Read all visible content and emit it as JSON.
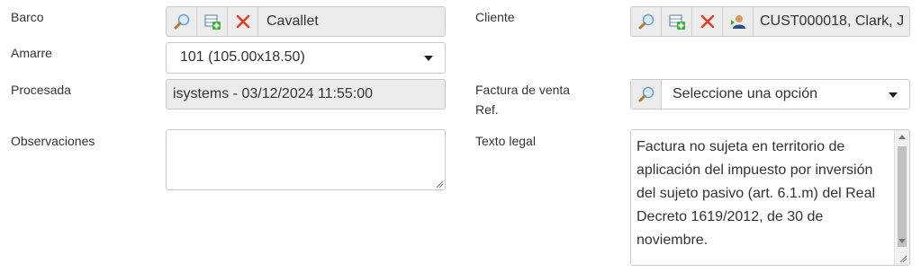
{
  "labels": {
    "barco": "Barco",
    "amarre": "Amarre",
    "procesada": "Procesada",
    "observaciones": "Observaciones",
    "cliente": "Cliente",
    "factura_line1": "Factura de venta",
    "factura_line2": "Ref.",
    "texto_legal": "Texto legal"
  },
  "barco": {
    "value": "Cavallet"
  },
  "amarre": {
    "selected": "101 (105.00x18.50)"
  },
  "procesada": {
    "value": "isystems - 03/12/2024 11:55:00"
  },
  "observaciones": {
    "value": ""
  },
  "cliente": {
    "value": "CUST000018, Clark, J"
  },
  "factura": {
    "placeholder": "Seleccione una opción"
  },
  "texto_legal": {
    "value": "Factura no sujeta en territorio de aplicación del impuesto por inversión del sujeto pasivo (art. 6.1.m) del Real Decreto 1619/2012, de 30 de noviembre."
  },
  "colors": {
    "delete": "#e23c2c",
    "search_glass": "#7aa9d8",
    "readonly_bg": "#ececec"
  }
}
